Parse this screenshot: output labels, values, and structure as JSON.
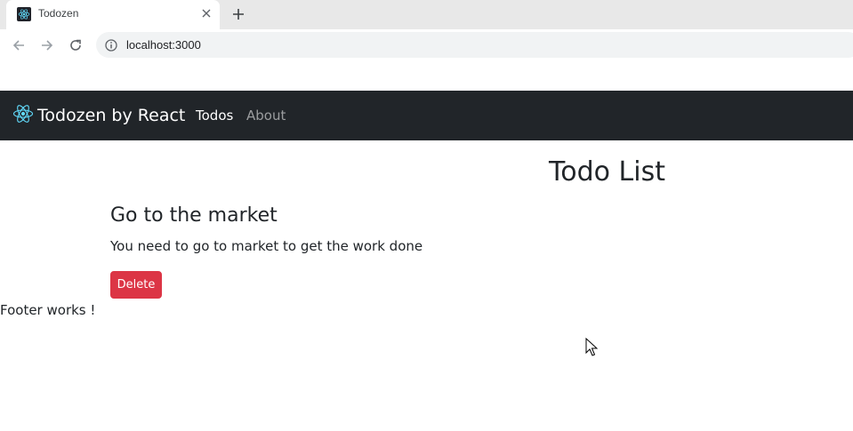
{
  "browser": {
    "tab": {
      "title": "Todozen"
    },
    "address_bar": {
      "url": "localhost:3000"
    }
  },
  "navbar": {
    "brand": "Todozen by React",
    "links": [
      {
        "label": "Todos",
        "active": true
      },
      {
        "label": "About",
        "active": false
      }
    ]
  },
  "main": {
    "title": "Todo List",
    "todos": [
      {
        "title": "Go to the market",
        "desc": "You need to go to market to get the work done",
        "delete_label": "Delete"
      }
    ]
  },
  "footer": {
    "text": "Footer works !"
  },
  "colors": {
    "navbar_bg": "#212529",
    "danger": "#dc3545",
    "react_cyan": "#61dafb"
  },
  "icons": [
    "react-logo-icon",
    "close-icon",
    "plus-icon",
    "back-arrow-icon",
    "forward-arrow-icon",
    "reload-icon",
    "info-icon",
    "mouse-cursor-icon"
  ]
}
